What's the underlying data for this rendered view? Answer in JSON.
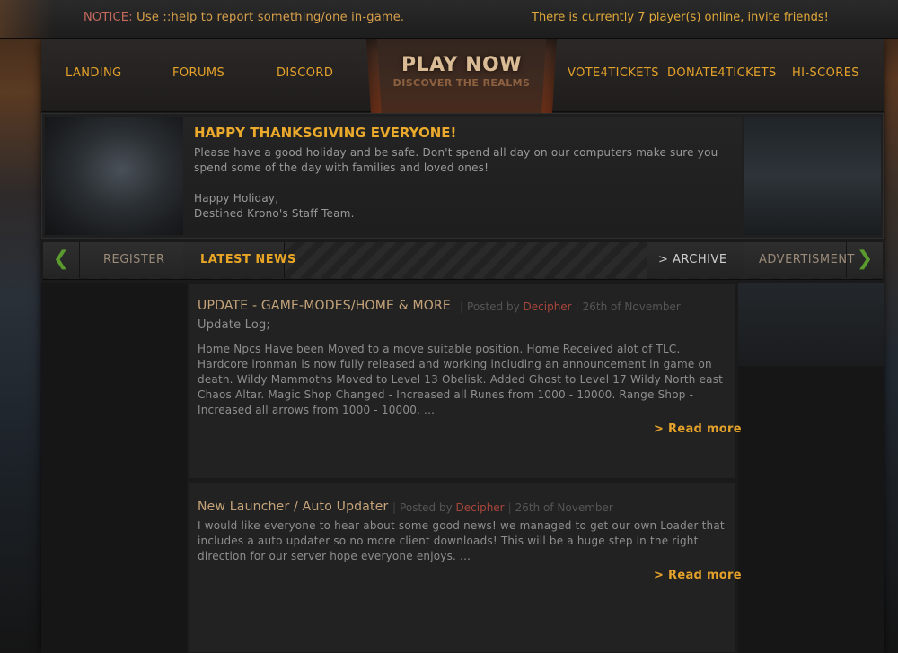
{
  "notice": {
    "label": "NOTICE:",
    "text": " Use ::help to report something/one in-game."
  },
  "online_text": "There is currently 7 player(s) online, invite friends!",
  "nav": {
    "landing": "LANDING",
    "forums": "FORUMS",
    "discord": "DISCORD",
    "play_title": "PLAY NOW",
    "play_subtitle": "DISCOVER THE REALMS",
    "vote": "VOTE4TICKETS",
    "donate": "DONATE4TICKETS",
    "hiscores": "HI-SCORES"
  },
  "banner": {
    "title": "HAPPY THANKSGIVING EVERYONE!",
    "line1": "Please have a good holiday and be safe. Don't spend all day on our computers make sure you spend some of the day with families and loved ones!",
    "line2": "Happy Holiday,",
    "line3": "Destined Krono's Staff Team."
  },
  "tabs": {
    "register": "REGISTER",
    "latest_news": "LATEST NEWS",
    "archive": ">  ARCHIVE",
    "advertisment": "ADVERTISMENT"
  },
  "icons": {
    "prev": "chevron-left-icon",
    "next": "chevron-right-icon"
  },
  "colors": {
    "accent": "#e5a22a",
    "author": "#a8463c",
    "arrow": "#5b9a2e"
  },
  "posts": [
    {
      "title": "UPDATE - GAME-MODES/HOME & MORE",
      "posted_by_label": "Posted by",
      "author": "Decipher",
      "date": "26th of November",
      "intro": "Update Log;",
      "body": "Home Npcs Have been Moved to a move suitable position. Home Received alot of TLC. Hardcore ironman is now fully released and working including an announcement in game on death. Wildy Mammoths Moved to Level 13 Obelisk. Added Ghost to Level 17 Wildy North east Chaos Altar. Magic Shop Changed - Increased all Runes from 1000 - 10000. Range Shop - Increased all arrows from 1000 -  10000. ...",
      "read_more": "> Read more"
    },
    {
      "title": "New Launcher / Auto Updater",
      "posted_by_label": "Posted by",
      "author": "Decipher",
      "date": "26th of November",
      "body": "I would like everyone to hear about some good news! we managed to get our own Loader that includes a auto updater so no more client downloads! This will be a huge step in the right direction for our server hope everyone enjoys.  ...",
      "read_more": "> Read more"
    }
  ]
}
